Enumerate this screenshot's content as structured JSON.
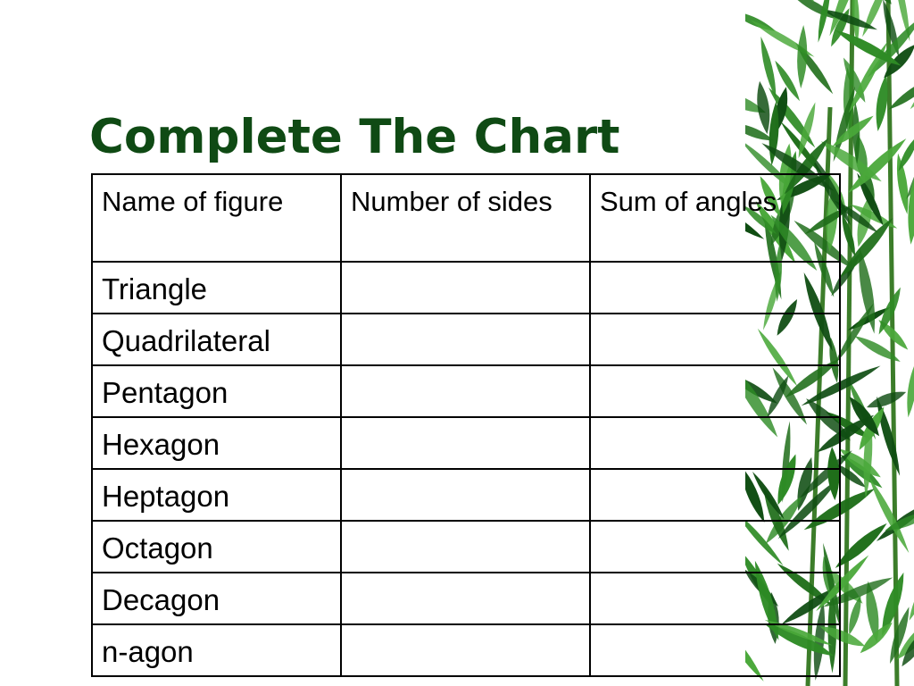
{
  "slide": {
    "title": "Complete The Chart",
    "title_color": "#0f4a14"
  },
  "table": {
    "headers": [
      "Name of figure",
      "Number of sides",
      "Sum of angles"
    ],
    "rows": [
      [
        "Triangle",
        "",
        ""
      ],
      [
        "Quadrilateral",
        "",
        ""
      ],
      [
        "Pentagon",
        "",
        ""
      ],
      [
        "Hexagon",
        "",
        ""
      ],
      [
        "Heptagon",
        "",
        ""
      ],
      [
        "Octagon",
        "",
        ""
      ],
      [
        "Decagon",
        "",
        ""
      ],
      [
        "n-agon",
        "",
        ""
      ]
    ]
  },
  "decoration": {
    "icon": "bamboo-leaves-icon",
    "leaf_colors": [
      "#1f6e1a",
      "#2e8b25",
      "#4aa83a",
      "#0f4d12"
    ]
  }
}
